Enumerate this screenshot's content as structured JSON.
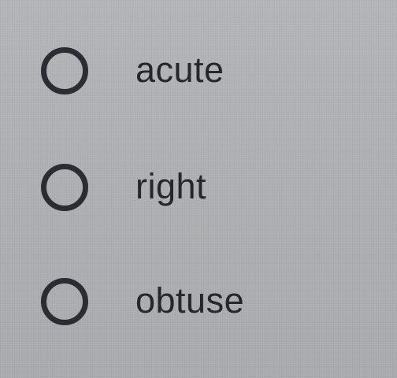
{
  "question": {
    "options": [
      {
        "label": "acute",
        "selected": false
      },
      {
        "label": "right",
        "selected": false
      },
      {
        "label": "obtuse",
        "selected": false
      }
    ]
  },
  "colors": {
    "background": "#aeb0b3",
    "radio_border": "#2b2d33",
    "text": "#26272b"
  }
}
